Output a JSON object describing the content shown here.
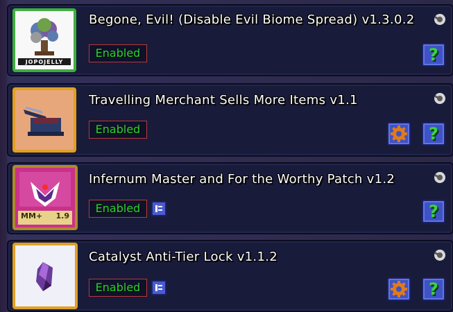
{
  "mods": [
    {
      "title": "Begone, Evil! (Disable Evil Biome Spread) v1.3.0.2",
      "status": "Enabled",
      "icon_name": "evil-tree-icon",
      "icon_watermark": "JOPOJELLY",
      "frame_color": "#3fae3f",
      "has_config": false,
      "has_description": false
    },
    {
      "title": "Travelling Merchant Sells More Items v1.1",
      "status": "Enabled",
      "icon_name": "merchant-hat-icon",
      "frame_color": "#e0a020",
      "has_config": true,
      "has_description": false
    },
    {
      "title": "Infernum Master and For the Worthy Patch v1.2",
      "status": "Enabled",
      "icon_name": "infernum-emblem-icon",
      "icon_badge_left": "MM+",
      "icon_badge_right": "1.9",
      "frame_color": "#b08a2a",
      "has_config": false,
      "has_description": true
    },
    {
      "title": "Catalyst Anti-Tier Lock v1.1.2",
      "status": "Enabled",
      "icon_name": "purple-crystal-icon",
      "frame_color": "#e0a020",
      "has_config": true,
      "has_description": true
    }
  ],
  "help_glyph": "?",
  "colors": {
    "panel": "#191b3b",
    "enabled_text": "#2fd42f",
    "enabled_border": "#b83a3a",
    "button_blue": "#3f53c6"
  }
}
